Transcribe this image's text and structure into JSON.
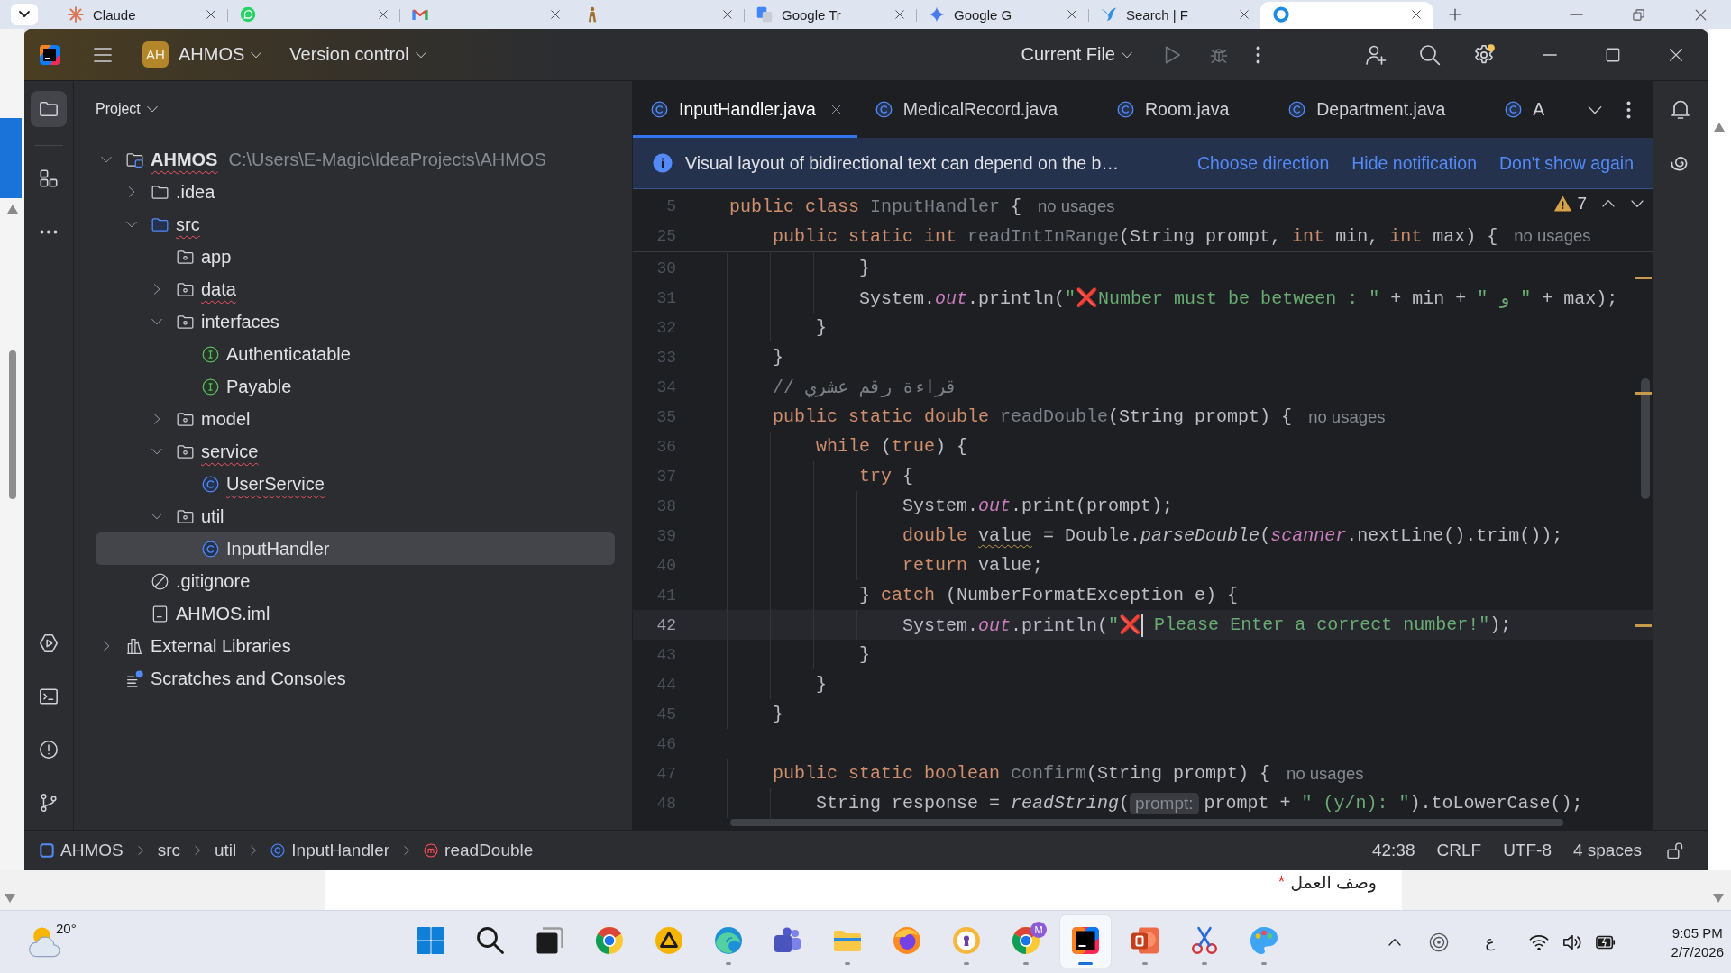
{
  "browser": {
    "tabs": [
      {
        "kind": "sparkle",
        "title": "Claude",
        "selected": false
      },
      {
        "kind": "chat",
        "selected": false
      },
      {
        "kind": "mail",
        "selected": false
      },
      {
        "kind": "figure",
        "selected": false
      },
      {
        "kind": "tiles",
        "title": "Google Tr",
        "selected": false
      },
      {
        "kind": "star",
        "title": "Google G",
        "selected": false
      },
      {
        "kind": "bird",
        "title": "Search | F",
        "selected": false
      },
      {
        "kind": "ring",
        "selected": true
      }
    ],
    "page": {
      "label": "وصف العمل",
      "required_mark": "*"
    }
  },
  "ide": {
    "title_bar": {
      "project_badge": "AH",
      "project": "AHMOS",
      "vcs": "Version control",
      "run_config": "Current File",
      "run_enabled": false,
      "settings_badge": true
    },
    "tool_windows_top": [
      {
        "kind": "project",
        "selected": true
      },
      {
        "kind": "structure",
        "selected": false
      },
      {
        "kind": "more",
        "selected": false
      }
    ],
    "tool_windows_bottom": [
      {
        "kind": "run",
        "selected": false
      },
      {
        "kind": "terminal",
        "selected": false
      },
      {
        "kind": "problems",
        "selected": false
      },
      {
        "kind": "git",
        "selected": false
      }
    ],
    "project_panel": {
      "title": "Project",
      "tree": [
        {
          "label": "AHMOS",
          "kind": "project",
          "path": "C:\\Users\\E-Magic\\IdeaProjects\\AHMOS",
          "expanded": true,
          "selected": false,
          "error": true,
          "children": [
            {
              "label": ".idea",
              "kind": "folder",
              "expanded": false,
              "selected": false,
              "error": false
            },
            {
              "label": "src",
              "kind": "source",
              "expanded": true,
              "selected": false,
              "error": true,
              "children": [
                {
                  "label": "app",
                  "kind": "package",
                  "selected": false,
                  "error": false
                },
                {
                  "label": "data",
                  "kind": "package",
                  "expanded": false,
                  "selected": false,
                  "error": true
                },
                {
                  "label": "interfaces",
                  "kind": "package",
                  "expanded": true,
                  "selected": false,
                  "error": false,
                  "children": [
                    {
                      "label": "Authenticatable",
                      "kind": "interface",
                      "selected": false,
                      "error": false
                    },
                    {
                      "label": "Payable",
                      "kind": "interface",
                      "selected": false,
                      "error": false
                    }
                  ]
                },
                {
                  "label": "model",
                  "kind": "package",
                  "expanded": false,
                  "selected": false,
                  "error": false
                },
                {
                  "label": "service",
                  "kind": "package",
                  "expanded": true,
                  "selected": false,
                  "error": true,
                  "children": [
                    {
                      "label": "UserService",
                      "kind": "class",
                      "selected": false,
                      "error": true
                    }
                  ]
                },
                {
                  "label": "util",
                  "kind": "package",
                  "expanded": true,
                  "selected": false,
                  "error": false,
                  "children": [
                    {
                      "label": "InputHandler",
                      "kind": "class",
                      "selected": true,
                      "error": false
                    }
                  ]
                }
              ]
            },
            {
              "label": ".gitignore",
              "kind": "ignore",
              "selected": false,
              "error": false
            },
            {
              "label": "AHMOS.iml",
              "kind": "module_file",
              "selected": false,
              "error": false
            }
          ]
        },
        {
          "label": "External Libraries",
          "kind": "libraries",
          "expanded": false,
          "selected": false,
          "error": false
        },
        {
          "label": "Scratches and Consoles",
          "kind": "scratches",
          "selected": false,
          "error": false
        }
      ]
    },
    "editor": {
      "tabs": [
        {
          "label": "InputHandler.java",
          "selected": true
        },
        {
          "label": "MedicalRecord.java",
          "selected": false
        },
        {
          "label": "Room.java",
          "selected": false
        },
        {
          "label": "Department.java",
          "selected": false
        },
        {
          "label": "A",
          "selected": false
        }
      ],
      "notification": {
        "text": "Visual layout of bidirectional text can depend on the b…",
        "actions": [
          "Choose direction",
          "Hide notification",
          "Don't show again"
        ]
      },
      "problems_count": "7",
      "sticky_lines": [
        {
          "number": "5",
          "tokens": [
            {
              "kind": "keyword",
              "text": "public class "
            },
            {
              "kind": "decl",
              "text": "InputHandler"
            },
            {
              "kind": "plain",
              "text": " {"
            },
            {
              "kind": "hint",
              "text": "no usages"
            }
          ]
        },
        {
          "number": "25",
          "tokens": [
            {
              "kind": "keyword",
              "text": "    public static int "
            },
            {
              "kind": "decl",
              "text": "readIntInRange"
            },
            {
              "kind": "plain",
              "text": "(String prompt, "
            },
            {
              "kind": "keyword",
              "text": "int"
            },
            {
              "kind": "plain",
              "text": " min, "
            },
            {
              "kind": "keyword",
              "text": "int"
            },
            {
              "kind": "plain",
              "text": " max) {"
            },
            {
              "kind": "hint",
              "text": "no usages"
            }
          ]
        }
      ],
      "lines": [
        {
          "number": "30",
          "current": false,
          "tokens": [
            {
              "kind": "plain",
              "text": "            }"
            }
          ]
        },
        {
          "number": "31",
          "current": false,
          "tokens": [
            {
              "kind": "plain",
              "text": "            System."
            },
            {
              "kind": "field",
              "text": "out"
            },
            {
              "kind": "plain",
              "text": ".println("
            },
            {
              "kind": "string",
              "text": "\""
            },
            {
              "kind": "emoji",
              "text": "❌"
            },
            {
              "kind": "string",
              "text": "Number must be between : \""
            },
            {
              "kind": "plain",
              "text": " + min + "
            },
            {
              "kind": "string",
              "text": "\" و \""
            },
            {
              "kind": "plain",
              "text": " + max);"
            }
          ]
        },
        {
          "number": "32",
          "current": false,
          "tokens": [
            {
              "kind": "plain",
              "text": "        }"
            }
          ]
        },
        {
          "number": "33",
          "current": false,
          "tokens": [
            {
              "kind": "plain",
              "text": "    }"
            }
          ]
        },
        {
          "number": "34",
          "current": false,
          "tokens": [
            {
              "kind": "comment",
              "text": "    // قراءة رقم عشري"
            }
          ]
        },
        {
          "number": "35",
          "current": false,
          "tokens": [
            {
              "kind": "keyword",
              "text": "    public static double "
            },
            {
              "kind": "decl",
              "text": "readDouble"
            },
            {
              "kind": "plain",
              "text": "(String prompt) {"
            },
            {
              "kind": "hint",
              "text": "no usages"
            }
          ]
        },
        {
          "number": "36",
          "current": false,
          "tokens": [
            {
              "kind": "keyword",
              "text": "        while "
            },
            {
              "kind": "plain",
              "text": "("
            },
            {
              "kind": "keyword",
              "text": "true"
            },
            {
              "kind": "plain",
              "text": ") {"
            }
          ]
        },
        {
          "number": "37",
          "current": false,
          "tokens": [
            {
              "kind": "keyword",
              "text": "            try "
            },
            {
              "kind": "plain",
              "text": "{"
            }
          ]
        },
        {
          "number": "38",
          "current": false,
          "tokens": [
            {
              "kind": "plain",
              "text": "                System."
            },
            {
              "kind": "field",
              "text": "out"
            },
            {
              "kind": "plain",
              "text": ".print(prompt);"
            }
          ]
        },
        {
          "number": "39",
          "current": false,
          "tokens": [
            {
              "kind": "keyword",
              "text": "                double "
            },
            {
              "kind": "warn",
              "text": "value"
            },
            {
              "kind": "plain",
              "text": " = Double."
            },
            {
              "kind": "static_call",
              "text": "parseDouble"
            },
            {
              "kind": "plain",
              "text": "("
            },
            {
              "kind": "field",
              "text": "scanner"
            },
            {
              "kind": "plain",
              "text": ".nextLine().trim());"
            }
          ]
        },
        {
          "number": "40",
          "current": false,
          "tokens": [
            {
              "kind": "keyword",
              "text": "                return "
            },
            {
              "kind": "plain",
              "text": "value;"
            }
          ]
        },
        {
          "number": "41",
          "current": false,
          "tokens": [
            {
              "kind": "plain",
              "text": "            } "
            },
            {
              "kind": "keyword",
              "text": "catch "
            },
            {
              "kind": "plain",
              "text": "(NumberFormatException e) {"
            }
          ]
        },
        {
          "number": "42",
          "current": true,
          "tokens": [
            {
              "kind": "plain",
              "text": "                System."
            },
            {
              "kind": "field",
              "text": "out"
            },
            {
              "kind": "plain",
              "text": ".println("
            },
            {
              "kind": "string",
              "text": "\""
            },
            {
              "kind": "emoji",
              "text": "❌"
            },
            {
              "kind": "caret"
            },
            {
              "kind": "string",
              "text": " Please Enter a correct number!\""
            },
            {
              "kind": "plain",
              "text": ");"
            }
          ]
        },
        {
          "number": "43",
          "current": false,
          "tokens": [
            {
              "kind": "plain",
              "text": "            }"
            }
          ]
        },
        {
          "number": "44",
          "current": false,
          "tokens": [
            {
              "kind": "plain",
              "text": "        }"
            }
          ]
        },
        {
          "number": "45",
          "current": false,
          "tokens": [
            {
              "kind": "plain",
              "text": "    }"
            }
          ]
        },
        {
          "number": "46",
          "current": false
        },
        {
          "number": "47",
          "current": false,
          "tokens": [
            {
              "kind": "keyword",
              "text": "    public static boolean "
            },
            {
              "kind": "decl",
              "text": "confirm"
            },
            {
              "kind": "plain",
              "text": "(String prompt) {"
            },
            {
              "kind": "hint",
              "text": "no usages"
            }
          ]
        },
        {
          "number": "48",
          "current": false,
          "tokens": [
            {
              "kind": "plain",
              "text": "        String response = "
            },
            {
              "kind": "static_call",
              "text": "readString"
            },
            {
              "kind": "plain",
              "text": "("
            },
            {
              "kind": "param",
              "text": "prompt:"
            },
            {
              "kind": "plain",
              "text": "prompt + "
            },
            {
              "kind": "string",
              "text": "\" (y/n): \""
            },
            {
              "kind": "plain",
              "text": ").toLowerCase();"
            }
          ]
        }
      ]
    },
    "right_toolbar": [
      {
        "kind": "notifications"
      },
      {
        "kind": "ai_assistant"
      }
    ],
    "status_bar": {
      "breadcrumbs": [
        {
          "kind": "module",
          "label": "AHMOS"
        },
        {
          "label": "src"
        },
        {
          "label": "util"
        },
        {
          "kind": "class",
          "label": "InputHandler"
        },
        {
          "kind": "method",
          "label": "readDouble"
        }
      ],
      "items": [
        "42:38",
        "CRLF",
        "UTF-8",
        "4 spaces"
      ]
    }
  },
  "taskbar": {
    "weather": "20°",
    "apps": [
      {
        "kind": "start",
        "running": false,
        "selected": false
      },
      {
        "kind": "search",
        "running": false,
        "selected": false
      },
      {
        "kind": "task_view",
        "running": false,
        "selected": false
      },
      {
        "kind": "chrome",
        "running": false,
        "selected": false
      },
      {
        "kind": "triangle",
        "running": false,
        "selected": false
      },
      {
        "kind": "edge",
        "running": true,
        "selected": false
      },
      {
        "kind": "teams",
        "running": false,
        "selected": false
      },
      {
        "kind": "files",
        "running": true,
        "selected": false
      },
      {
        "kind": "firefox",
        "running": false,
        "selected": false
      },
      {
        "kind": "keyhole",
        "running": true,
        "selected": false
      },
      {
        "kind": "chrome",
        "badge": "M",
        "running": true,
        "selected": false
      },
      {
        "kind": "ide",
        "running": true,
        "selected": true
      },
      {
        "kind": "slides",
        "running": true,
        "selected": false
      },
      {
        "kind": "snipping",
        "running": true,
        "selected": false
      },
      {
        "kind": "paint",
        "running": true,
        "selected": false
      }
    ],
    "tray": {
      "language": "ع",
      "time": "9:05 PM",
      "date": "2/7/2026"
    }
  }
}
